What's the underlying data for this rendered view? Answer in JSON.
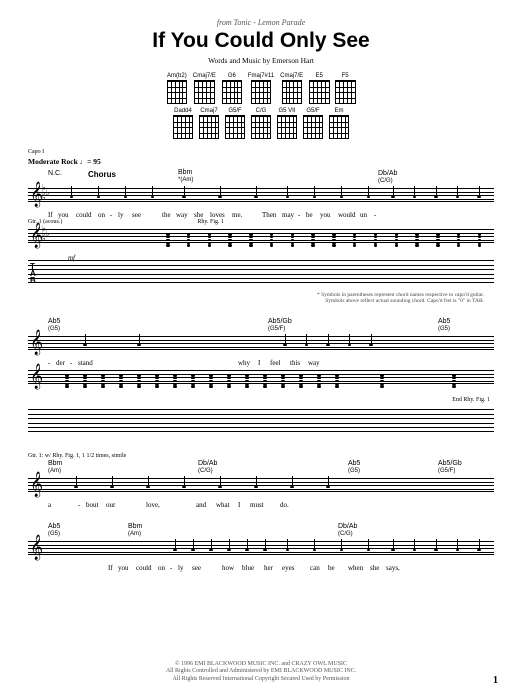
{
  "header": {
    "from_line": "from Tonic - Lemon Parade",
    "title": "If You Could Only See",
    "subtitle": "Words and Music by Emerson Hart"
  },
  "chord_grids": {
    "row1": [
      "Am(b2)",
      "Cmaj7/E",
      "G6",
      "Fmaj7#11",
      "Cmaj7/E",
      "E5",
      "F5"
    ],
    "row2": [
      "Dadd4",
      "Cmaj7",
      "G5/F",
      "C/G",
      "G5 VII",
      "G5/F",
      "Em"
    ]
  },
  "play_info": "Capo I",
  "tempo": "Moderate Rock ♩= 95",
  "system1": {
    "nc_label": "N.C.",
    "section": "Chorus",
    "chord1": "Bbm",
    "chord1_cap": "*(Am)",
    "chord2": "Db/Ab",
    "chord2_cap": "(C/G)",
    "lyrics": [
      "If",
      "you",
      "could",
      "on",
      "-",
      "ly",
      "see",
      "the",
      "way",
      "she",
      "loves",
      "me.",
      "Then",
      "may",
      "-",
      "be",
      "you",
      "would",
      "un",
      "-"
    ],
    "gtr_label": "Gtr. 1 (acous.)",
    "rhy_label": "Rhy. Fig. 1",
    "dynamic": "mf",
    "footnote": "* Symbols in parentheses represent chord names respective to capo'd guitar.\nSymbols above reflect actual sounding chord. Capo'd fret is \"0\" in TAB."
  },
  "system2": {
    "chord1": "Ab5",
    "chord1_cap": "(G5)",
    "chord2": "Ab5/Gb",
    "chord2_cap": "(G5/F)",
    "chord3": "Ab5",
    "chord3_cap": "(G5)",
    "lyrics": [
      "-",
      "der",
      "-",
      "stand",
      "why",
      "I",
      "feel",
      "this",
      "way"
    ],
    "end_label": "End Rhy. Fig. 1"
  },
  "system3": {
    "gtr_label": "Gtr. 1: w/ Rhy. Fig. 1, 1 1/2 times, simile",
    "chord1": "Bbm",
    "chord1_cap": "(Am)",
    "chord2": "Db/Ab",
    "chord2_cap": "(C/G)",
    "chord3": "Ab5",
    "chord3_cap": "(G5)",
    "chord4": "Ab5/Gb",
    "chord4_cap": "(G5/F)",
    "lyrics": [
      "a",
      "-",
      "bout",
      "our",
      "love,",
      "and",
      "what",
      "I",
      "must",
      "do."
    ]
  },
  "system4": {
    "chord1": "Ab5",
    "chord1_cap": "(G5)",
    "chord2": "Bbm",
    "chord2_cap": "(Am)",
    "chord3": "Db/Ab",
    "chord3_cap": "(C/G)",
    "lyrics": [
      "If",
      "you",
      "could",
      "on",
      "-",
      "ly",
      "see",
      "how",
      "blue",
      "her",
      "eyes",
      "can",
      "be",
      "when",
      "she",
      "says,"
    ]
  },
  "copyright": {
    "line1": "© 1996 EMI BLACKWOOD MUSIC INC. and CRAZY OWL MUSIC",
    "line2": "All Rights Controlled and Administered by EMI BLACKWOOD MUSIC INC.",
    "line3": "All Rights Reserved   International Copyright Secured   Used by Permission"
  },
  "page_number": "1"
}
